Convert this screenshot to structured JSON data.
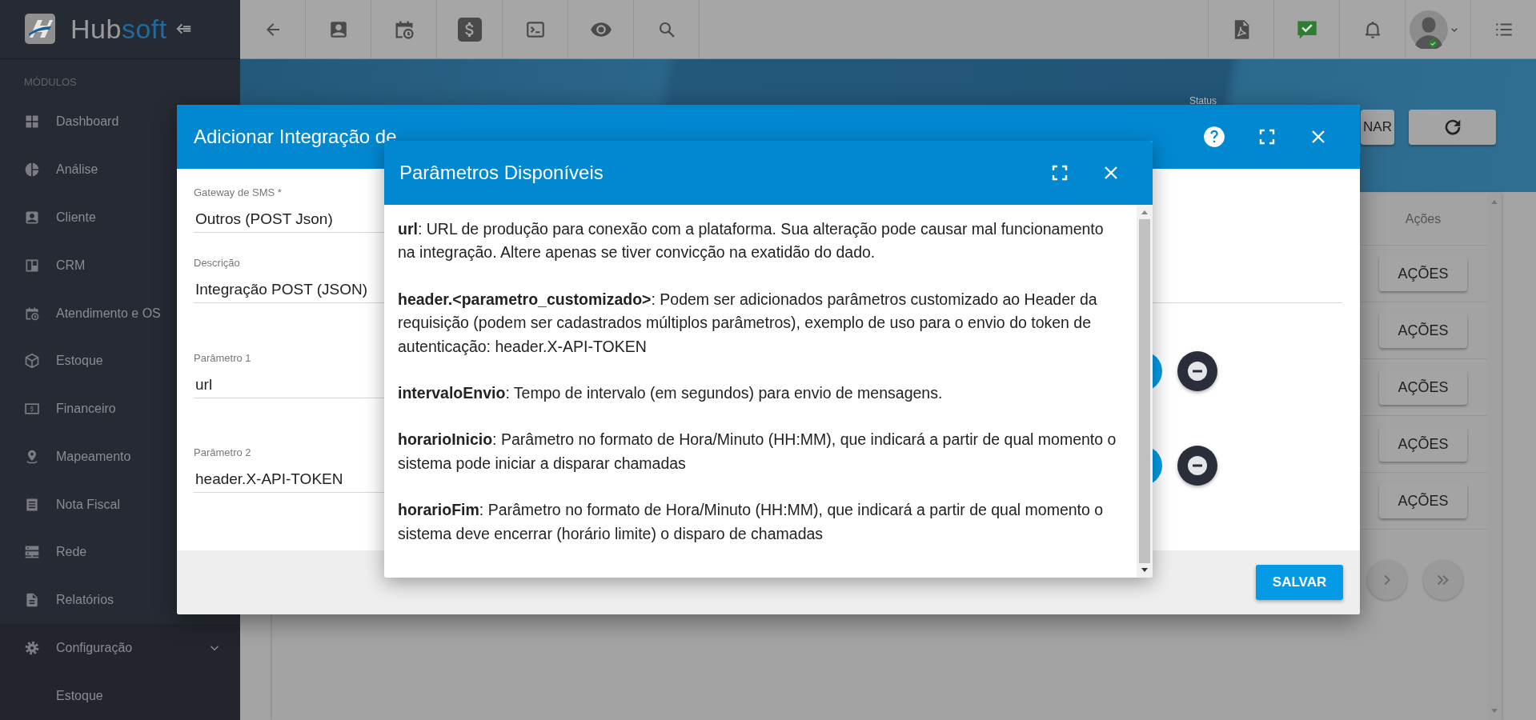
{
  "sidebar": {
    "logo_text": [
      "Hub",
      "soft"
    ],
    "section_label": "MÓDULOS",
    "items": [
      {
        "kind": "link",
        "label": "Dashboard"
      },
      {
        "kind": "link",
        "label": "Análise"
      },
      {
        "kind": "link",
        "label": "Cliente"
      },
      {
        "kind": "link",
        "label": "CRM"
      },
      {
        "kind": "link",
        "label": "Atendimento e OS"
      },
      {
        "kind": "link",
        "label": "Estoque"
      },
      {
        "kind": "link",
        "label": "Financeiro"
      },
      {
        "kind": "link",
        "label": "Mapeamento"
      },
      {
        "kind": "link",
        "label": "Nota Fiscal"
      },
      {
        "kind": "link",
        "label": "Rede"
      },
      {
        "kind": "link",
        "label": "Relatórios"
      },
      {
        "kind": "group",
        "label": "Configuração",
        "expanded": true,
        "children": [
          {
            "label": "Estoque"
          }
        ]
      }
    ]
  },
  "page": {
    "status_label": "Status",
    "filter_button": "NAR",
    "table": {
      "columns": [
        "Ações"
      ],
      "rows": [
        {
          "action": "AÇÕES"
        },
        {
          "action": "AÇÕES"
        },
        {
          "action": "AÇÕES"
        },
        {
          "action": "AÇÕES"
        },
        {
          "action": "AÇÕES"
        }
      ]
    }
  },
  "modal": {
    "title": "Adicionar Integração de",
    "fields": [
      {
        "label": "Gateway de SMS *",
        "value": "Outros (POST Json)"
      },
      {
        "label": "Descrição",
        "value": "Integração POST (JSON)"
      }
    ],
    "parameters": [
      {
        "label": "Parâmetro 1",
        "value": "url"
      },
      {
        "label": "Parâmetro 2",
        "value": "header.X-API-TOKEN"
      }
    ],
    "save_button": "SALVAR"
  },
  "dialog": {
    "title": "Parâmetros Disponíveis",
    "paragraphs": [
      "**url**: URL de produção para conexão com a plataforma. Sua alteração pode causar mal funcionamento na integração. Altere apenas se tiver convicção na exatidão do dado.",
      "**header.<parametro_customizado>**: Podem ser adicionados parâmetros customizado ao Header da requisição (podem ser cadastrados múltiplos parâmetros), exemplo de uso para o envio do token de autenticação: header.X-API-TOKEN",
      "**intervaloEnvio**: Tempo de intervalo (em segundos) para envio de mensagens.",
      "**horarioInicio**: Parâmetro no formato de Hora/Minuto (HH:MM), que indicará a partir de qual momento o sistema pode iniciar a disparar chamadas",
      "**horarioFim**: Parâmetro no formato de Hora/Minuto (HH:MM), que indicará a partir de qual momento o sistema deve encerrar (horário limite) o disparo de chamadas"
    ]
  }
}
